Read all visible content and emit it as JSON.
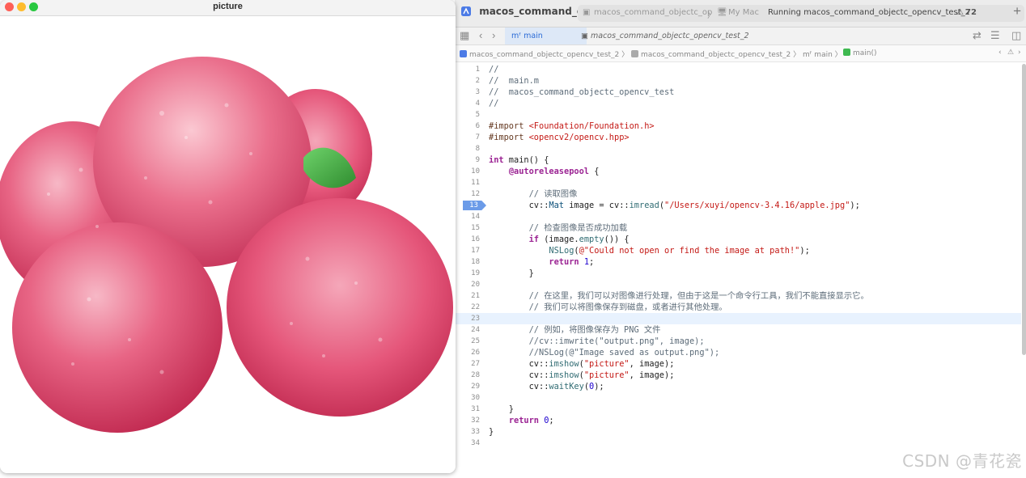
{
  "cv_window": {
    "title": "picture",
    "image_alt": "apples"
  },
  "xcode": {
    "project": "macos_command_o...",
    "scheme_target": "macos_command_objectc_op",
    "destination": "My Mac",
    "run_status": "Running macos_command_objectc_opencv_test_2",
    "warnings": "72",
    "tabs": [
      {
        "label": "main",
        "icon": "m-file-icon"
      },
      {
        "label": "macos_command_objectc_opencv_test_2",
        "icon": "app-icon"
      }
    ],
    "jumpbar": {
      "project": "macos_command_objectc_opencv_test_2",
      "folder": "macos_command_objectc_opencv_test_2",
      "file": "main",
      "symbol": "main()"
    },
    "lines": [
      {
        "n": "1",
        "t": "//"
      },
      {
        "n": "2",
        "t": "//  main.m"
      },
      {
        "n": "3",
        "t": "//  macos_command_objectc_opencv_test"
      },
      {
        "n": "4",
        "t": "//"
      },
      {
        "n": "5",
        "t": ""
      },
      {
        "n": "6",
        "t": "#import <Foundation/Foundation.h>"
      },
      {
        "n": "7",
        "t": "#import <opencv2/opencv.hpp>"
      },
      {
        "n": "8",
        "t": ""
      },
      {
        "n": "9",
        "t": "int main() {"
      },
      {
        "n": "10",
        "t": "    @autoreleasepool {"
      },
      {
        "n": "11",
        "t": ""
      },
      {
        "n": "12",
        "t": "        // 读取图像"
      },
      {
        "n": "13",
        "t": "        cv::Mat image = cv::imread(\"/Users/xuyi/opencv-3.4.16/apple.jpg\");"
      },
      {
        "n": "14",
        "t": ""
      },
      {
        "n": "15",
        "t": "        // 检查图像是否成功加载"
      },
      {
        "n": "16",
        "t": "        if (image.empty()) {"
      },
      {
        "n": "17",
        "t": "            NSLog(@\"Could not open or find the image at path!\");"
      },
      {
        "n": "18",
        "t": "            return 1;"
      },
      {
        "n": "19",
        "t": "        }"
      },
      {
        "n": "20",
        "t": ""
      },
      {
        "n": "21",
        "t": "        // 在这里，我们可以对图像进行处理，但由于这是一个命令行工具，我们不能直接显示它。"
      },
      {
        "n": "22",
        "t": "        // 我们可以将图像保存到磁盘，或者进行其他处理。"
      },
      {
        "n": "23",
        "t": ""
      },
      {
        "n": "24",
        "t": "        // 例如，将图像保存为 PNG 文件"
      },
      {
        "n": "25",
        "t": "        //cv::imwrite(\"output.png\", image);"
      },
      {
        "n": "26",
        "t": "        //NSLog(@\"Image saved as output.png\");"
      },
      {
        "n": "27",
        "t": "        cv::imshow(\"picture\", image);"
      },
      {
        "n": "28",
        "t": "        cv::imshow(\"picture\", image);"
      },
      {
        "n": "29",
        "t": "        cv::waitKey(0);"
      },
      {
        "n": "30",
        "t": ""
      },
      {
        "n": "31",
        "t": "    }"
      },
      {
        "n": "32",
        "t": "    return 0;"
      },
      {
        "n": "33",
        "t": "}"
      },
      {
        "n": "34",
        "t": ""
      }
    ],
    "breakpoint_line": "13",
    "current_line": "23",
    "watermark": "CSDN @青花瓷"
  },
  "colors": {
    "keyword": "#9b2393",
    "comment": "#5d6c79",
    "string": "#c41a16",
    "number": "#1c00cf",
    "breakpoint": "#6b9be8",
    "current_line": "#e8f2fe"
  }
}
